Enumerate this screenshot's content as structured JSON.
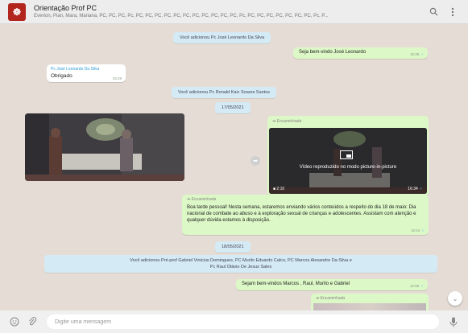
{
  "header": {
    "avatar_glyph": "☸",
    "title": "Orientação Prof PC",
    "subtitle": "Everton, Pian, Mara, Mariana, PC, PC, PC, Pc, PC, PC, PC, PC, PC, PC, PC, PC, PC, PC, PC, Pc, PC, PC, PC, PC, PC, PC, PC, Pc, P...",
    "search_icon": "search-icon",
    "menu_icon": "menu-icon"
  },
  "messages": {
    "sys_added_leonardo": "Você adicionou Pc José Leonardo Da Silva",
    "welcome_leonardo": {
      "text": "Seja bem-vindo José Leonardo",
      "time": "15:29"
    },
    "reply_leonardo": {
      "sender": "Pc José Leonardo Da Silva",
      "text": "Obrigado",
      "time": "15:49"
    },
    "sys_added_ronald": "Você adicionou Pc Ronald Kaic Soares Santos",
    "date_1": "17/05/2021",
    "forwarded_label": "Encaminhada",
    "video_pip": {
      "label": "Vídeo reproduzido no modo picture-in-picture",
      "size": "2:10",
      "time": "16:34"
    },
    "forwarded_text": {
      "label": "Encaminhada",
      "text": "Boa tarde pessoal! Nesta semana, estaremos enviando vários conteúdos a respeito do dia 18 de maio: Dia nacional de combate ao abuso e à exploração sexual de crianças e adolescentes. Assistam com atenção e qualquer dúvida estamos à disposição.",
      "time": "16:34"
    },
    "date_2": "18/05/2021",
    "sys_added_group_line1": "Você adicionou Pré-prof Gabriel Vinicius Domingues, PC Murilo Eduardo Calco, PC Marcos Alexandre Da Silva e",
    "sys_added_group_line2": "Pc Raul Otávio De Jesus Sales",
    "welcome_group": {
      "text": "Sejam bem-vindos Marcos , Raul, Murilo e Gabriel",
      "time": "12:59"
    },
    "forwarded_bottom_label": "Encaminhada"
  },
  "composer": {
    "placeholder": "Digite uma mensagem",
    "emoji_icon": "emoji-icon",
    "attach_icon": "paperclip-icon",
    "mic_icon": "mic-icon"
  }
}
